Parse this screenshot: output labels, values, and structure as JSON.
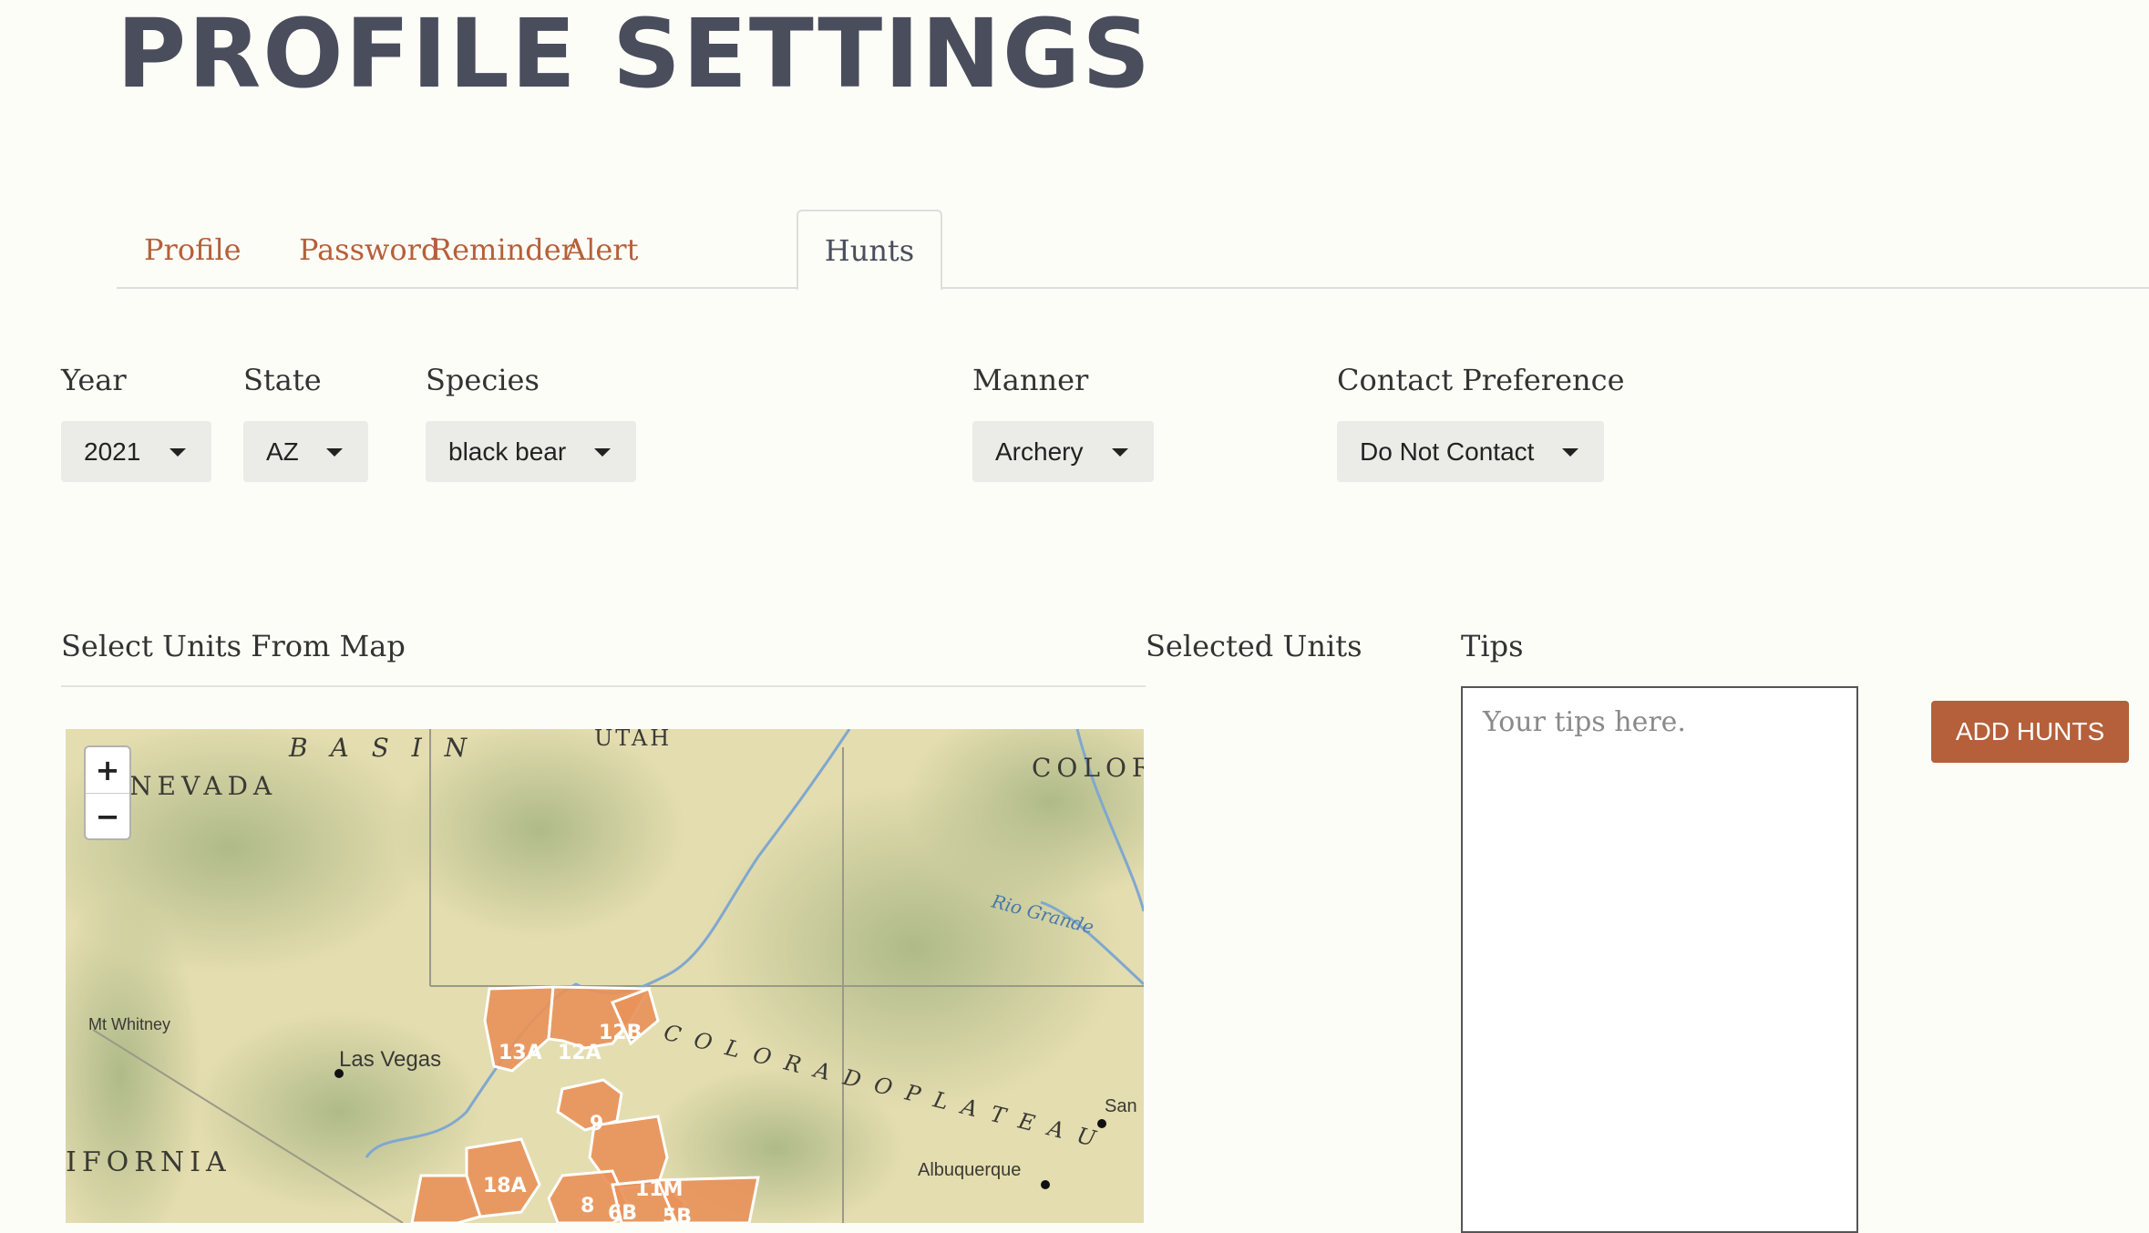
{
  "page": {
    "title": "PROFILE SETTINGS"
  },
  "tabs": [
    {
      "label": "Profile",
      "active": false
    },
    {
      "label": "Password",
      "active": false
    },
    {
      "label": "Reminder",
      "active": false
    },
    {
      "label": "Alert",
      "active": false
    },
    {
      "label": "Hunts",
      "active": true
    }
  ],
  "filters": {
    "year": {
      "label": "Year",
      "value": "2021"
    },
    "state": {
      "label": "State",
      "value": "AZ"
    },
    "species": {
      "label": "Species",
      "value": "black bear"
    },
    "manner": {
      "label": "Manner",
      "value": "Archery"
    },
    "contact": {
      "label": "Contact Preference",
      "value": "Do Not Contact"
    }
  },
  "sections": {
    "map_label": "Select Units From Map",
    "selected_label": "Selected Units",
    "tips_label": "Tips"
  },
  "map": {
    "zoom_in": "+",
    "zoom_out": "−",
    "place_labels": {
      "nevada": "NEVADA",
      "basin": "B A S I N",
      "utah": "UTAH",
      "colorado": "COLOR",
      "rio_grande": "Rio Grande",
      "mt_whitney": "Mt Whitney",
      "las_vegas": "Las Vegas",
      "colorado_plateau": "C O L O R A D O   P L A T E A U",
      "santa_fe": "San",
      "albuquerque": "Albuquerque",
      "california": "IFORNIA"
    },
    "unit_labels": [
      "12B",
      "13A",
      "12A",
      "9",
      "18A",
      "11M",
      "6B",
      "8",
      "5B"
    ],
    "unit_color": "#e8935a"
  },
  "tips": {
    "placeholder": "Your tips here."
  },
  "actions": {
    "add_hunts": "ADD HUNTS"
  },
  "colors": {
    "accent": "#b5603a",
    "title": "#4a4d5c"
  }
}
